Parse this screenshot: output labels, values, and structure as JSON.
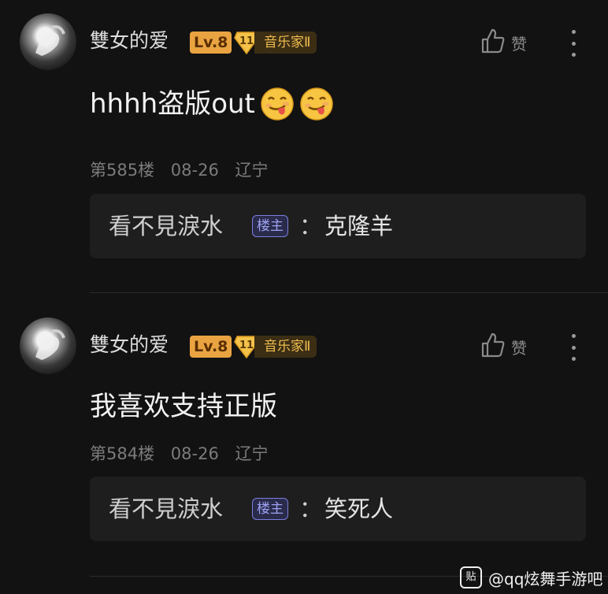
{
  "comments": [
    {
      "username": "雙女的爱",
      "level": "Lv.8",
      "badge_num": "11",
      "badge_label": "音乐家Ⅱ",
      "like_label": "赞",
      "content": "hhhh盗版out",
      "floor": "第585楼",
      "date": "08-26",
      "location": "辽宁",
      "reply": {
        "name": "看不見淚水",
        "tag": "楼主",
        "colon": "：",
        "text": "克隆羊"
      }
    },
    {
      "username": "雙女的爱",
      "level": "Lv.8",
      "badge_num": "11",
      "badge_label": "音乐家Ⅱ",
      "like_label": "赞",
      "content": "我喜欢支持正版",
      "floor": "第584楼",
      "date": "08-26",
      "location": "辽宁",
      "reply": {
        "name": "看不見淚水",
        "tag": "楼主",
        "colon": "：",
        "text": "笑死人"
      }
    }
  ],
  "watermark": {
    "logo": "贴",
    "text": "@qq炫舞手游吧"
  },
  "icons": {
    "like": "thumbs-up-icon",
    "more": "vertical-ellipsis-icon",
    "emoji": "face-savoring-food-icon",
    "badge": "gold-diamond-icon"
  },
  "colors": {
    "level_bg": "#e9a441",
    "badge_text": "#f1bd4f",
    "owner_tag": "#7b7fe0",
    "background": "#121212"
  }
}
